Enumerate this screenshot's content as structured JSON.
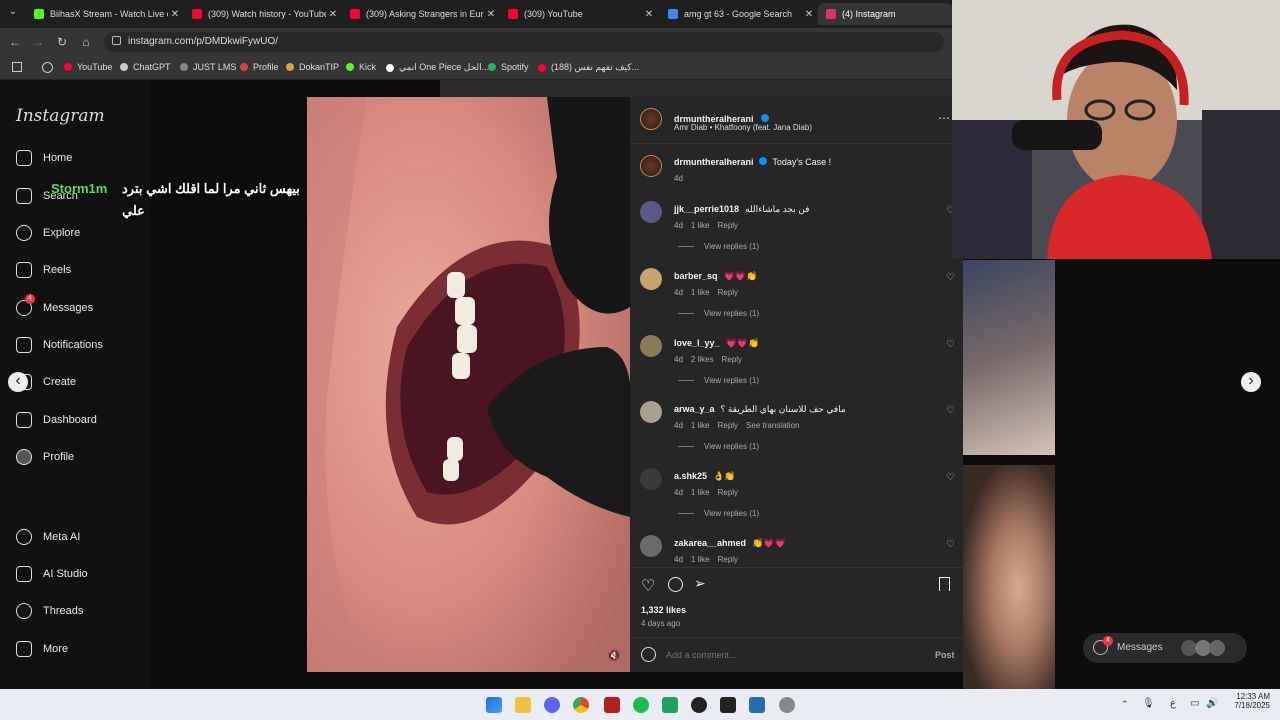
{
  "tabs": [
    {
      "title": "BiihasX Stream - Watch Live on",
      "icon": "kick-icon",
      "color": "#53fc18"
    },
    {
      "title": "(309) Watch history - YouTube",
      "icon": "youtube-icon",
      "color": "#ff0033"
    },
    {
      "title": "(309) Asking Strangers in Europ",
      "icon": "youtube-icon",
      "color": "#ff0033"
    },
    {
      "title": "(309) YouTube",
      "icon": "youtube-icon",
      "color": "#ff0033"
    },
    {
      "title": "amg gt 63 - Google Search",
      "icon": "google-icon",
      "color": "#4285f4"
    },
    {
      "title": "(4) Instagram",
      "icon": "instagram-icon",
      "color": "#e1306c"
    }
  ],
  "tab_close_glyph": "✕",
  "address": {
    "url": "instagram.com/p/DMDkwiFywUO/"
  },
  "bookmarks": [
    {
      "label": "YouTube",
      "color": "#ff0033"
    },
    {
      "label": "ChatGPT",
      "color": "#cccccc"
    },
    {
      "label": "JUST LMS",
      "color": "#888888"
    },
    {
      "label": "Profile",
      "color": "#e04040"
    },
    {
      "label": "DokanTIP",
      "color": "#e0a040"
    },
    {
      "label": "Kick",
      "color": "#53fc18"
    },
    {
      "label": "انمي One Piece الحل...",
      "color": "#ffffff"
    },
    {
      "label": "Spotify",
      "color": "#1db954"
    },
    {
      "label": "(188) كيف تفهم نفس...",
      "color": "#ff0033"
    }
  ],
  "sidebar": {
    "logo": "Instagram",
    "items": [
      {
        "label": "Home",
        "icon": "home-icon"
      },
      {
        "label": "Search",
        "icon": "search-icon"
      },
      {
        "label": "Explore",
        "icon": "compass-icon"
      },
      {
        "label": "Reels",
        "icon": "reels-icon"
      },
      {
        "label": "Messages",
        "icon": "messenger-icon",
        "badge": "4"
      },
      {
        "label": "Notifications",
        "icon": "heart-icon"
      },
      {
        "label": "Create",
        "icon": "plus-square-icon"
      },
      {
        "label": "Dashboard",
        "icon": "chart-icon"
      },
      {
        "label": "Profile",
        "icon": "avatar-icon"
      },
      {
        "label": "Meta AI",
        "icon": "meta-ai-icon"
      },
      {
        "label": "AI Studio",
        "icon": "ai-studio-icon"
      },
      {
        "label": "Threads",
        "icon": "threads-icon"
      },
      {
        "label": "More",
        "icon": "menu-icon"
      }
    ]
  },
  "overlay": {
    "streamer_tag": "Storm1m",
    "arabic_line1": "بيهس ثاني مرا لما اقلك اشي بترد",
    "arabic_line2": "علي"
  },
  "post": {
    "author": "drmuntheralherani",
    "audio": "Amr Diab • Khatfoony (feat. Jana Diab)",
    "caption_user": "drmuntheralherani",
    "caption": "Today's Case !",
    "caption_age": "4d",
    "likes": "1,332 likes",
    "age": "4 days ago",
    "comment_placeholder": "Add a comment...",
    "post_button": "Post"
  },
  "comments": [
    {
      "user": "jjk__perrie1018",
      "text": "فن بجد ماشاءالله",
      "age": "4d",
      "likes": "1 like",
      "reply": "Reply",
      "translate": "",
      "view": "View replies (1)",
      "avatar": "#5a5a8a"
    },
    {
      "user": "barber_sq",
      "text": "💗💗👏",
      "age": "4d",
      "likes": "1 like",
      "reply": "Reply",
      "translate": "",
      "view": "View replies (1)",
      "avatar": "#c9a36b"
    },
    {
      "user": "love_l_yy_",
      "text": "💗💗👏",
      "age": "4d",
      "likes": "2 likes",
      "reply": "Reply",
      "translate": "",
      "view": "View replies (1)",
      "avatar": "#8a7a5a"
    },
    {
      "user": "arwa_y_a",
      "text": "مافي حف للاسنان بهاي الطريقة ؟",
      "age": "4d",
      "likes": "1 like",
      "reply": "Reply",
      "translate": "See translation",
      "view": "View replies (1)",
      "avatar": "#a8a090"
    },
    {
      "user": "a.shk25",
      "text": "👌👏",
      "age": "4d",
      "likes": "1 like",
      "reply": "Reply",
      "translate": "",
      "view": "View replies (1)",
      "avatar": "#3a3a3a"
    },
    {
      "user": "zakarea__ahmed",
      "text": "👏💗💗",
      "age": "4d",
      "likes": "1 like",
      "reply": "Reply",
      "translate": "",
      "view": "",
      "avatar": "#6a6a6a"
    }
  ],
  "right_overlay": {
    "messages_label": "Messages",
    "messages_badge": "4"
  },
  "taskbar": {
    "time": "12:33 AM",
    "date": "7/18/2025",
    "lang": "ع"
  },
  "arrows": {
    "prev": "‹",
    "next": "›"
  },
  "colors": {
    "accent": "#0095f6",
    "verified": "#0095f6"
  }
}
